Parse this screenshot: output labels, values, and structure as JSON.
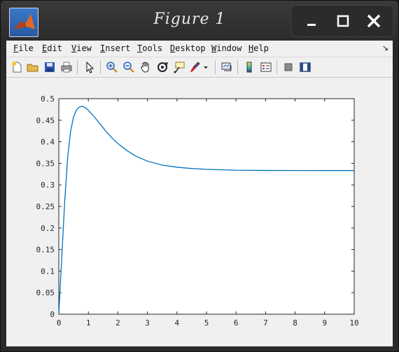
{
  "window": {
    "title": "Figure 1"
  },
  "menu": {
    "items": [
      {
        "acc": "F",
        "rest": "ile"
      },
      {
        "acc": "E",
        "rest": "dit"
      },
      {
        "acc": "V",
        "rest": "iew"
      },
      {
        "acc": "I",
        "rest": "nsert"
      },
      {
        "acc": "T",
        "rest": "ools"
      },
      {
        "acc": "D",
        "rest": "esktop"
      },
      {
        "acc": "W",
        "rest": "indow"
      },
      {
        "acc": "H",
        "rest": "elp"
      }
    ]
  },
  "toolbar": {
    "icons": [
      "new-figure-icon",
      "open-file-icon",
      "save-icon",
      "print-icon",
      "select-arrow-icon",
      "zoom-in-icon",
      "zoom-out-icon",
      "pan-hand-icon",
      "rotate-3d-icon",
      "data-cursor-icon",
      "brush-icon",
      "brush-dropdown-icon",
      "link-plot-icon",
      "colorbar-icon",
      "legend-icon",
      "hide-plot-tools-icon",
      "show-plot-tools-icon"
    ]
  },
  "colors": {
    "line": "#0072bd",
    "axes_bg": "#ffffff",
    "figure_bg": "#f0f0f0"
  },
  "chart_data": {
    "type": "line",
    "title": "",
    "xlabel": "",
    "ylabel": "",
    "xlim": [
      0,
      10
    ],
    "ylim": [
      0,
      0.5
    ],
    "xticks": [
      "0",
      "1",
      "2",
      "3",
      "4",
      "5",
      "6",
      "7",
      "8",
      "9",
      "10"
    ],
    "yticks": [
      "0",
      "0.05",
      "0.1",
      "0.15",
      "0.2",
      "0.25",
      "0.3",
      "0.35",
      "0.4",
      "0.45",
      "0.5"
    ],
    "grid": false,
    "series": [
      {
        "x": [
          0,
          0.1,
          0.2,
          0.3,
          0.4,
          0.5,
          0.6,
          0.7,
          0.8,
          0.9,
          1.0,
          1.2,
          1.4,
          1.6,
          1.8,
          2.0,
          2.3,
          2.6,
          3.0,
          3.5,
          4.0,
          4.5,
          5.0,
          5.5,
          6.0,
          7.0,
          8.0,
          9.0,
          10.0
        ],
        "y": [
          0,
          0.131,
          0.262,
          0.363,
          0.425,
          0.458,
          0.474,
          0.481,
          0.482,
          0.479,
          0.473,
          0.458,
          0.441,
          0.424,
          0.409,
          0.396,
          0.38,
          0.367,
          0.355,
          0.346,
          0.341,
          0.338,
          0.336,
          0.335,
          0.334,
          0.3335,
          0.3334,
          0.3333,
          0.3333
        ]
      }
    ]
  }
}
